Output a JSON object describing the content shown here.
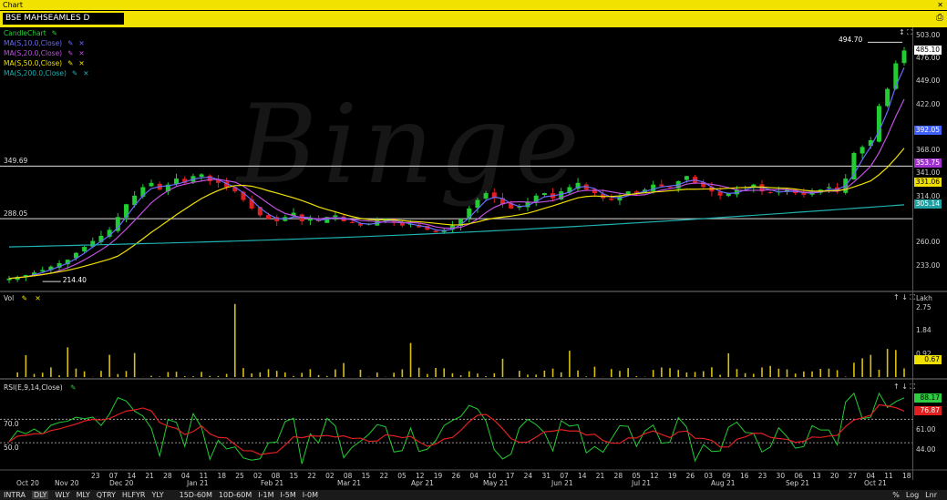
{
  "window": {
    "title": "Chart",
    "close": "✕"
  },
  "symbol": "BSE MAHSEAMLES D",
  "watermark": "Binge",
  "legend_price": [
    {
      "label": "CandleChart",
      "color": "#2ecc40"
    },
    {
      "label": "MA(S,10.0,Close)",
      "color": "#6a6aff"
    },
    {
      "label": "MA(S,20.0,Close)",
      "color": "#c050e0"
    },
    {
      "label": "MA(S,50.0,Close)",
      "color": "#f0e000"
    },
    {
      "label": "MA(S,200.0,Close)",
      "color": "#20b0b0"
    }
  ],
  "legend_vol": "Vol",
  "legend_rsi": "RSI(E,9,14,Close)",
  "price_axis": [
    "503.00",
    "476.00",
    "449.00",
    "422.00",
    "368.00",
    "341.00",
    "314.00",
    "260.00",
    "233.00"
  ],
  "price_tags": [
    {
      "text": "485.10",
      "bg": "#ffffff",
      "fg": "#000"
    },
    {
      "text": "392.05",
      "bg": "#4060ff",
      "fg": "#fff"
    },
    {
      "text": "353.75",
      "bg": "#a030d0",
      "fg": "#fff"
    },
    {
      "text": "331.06",
      "bg": "#f0e000",
      "fg": "#000"
    },
    {
      "text": "305.14",
      "bg": "#20a0a0",
      "fg": "#fff"
    }
  ],
  "price_annotations": {
    "high": "494.70",
    "low": "214.40",
    "line1": "349.69",
    "line2": "288.05"
  },
  "vol_unit": "Lakh",
  "vol_axis": [
    "2.75",
    "1.84",
    "0.92"
  ],
  "vol_tag": "0.67",
  "rsi_axis": [
    "61.00",
    "44.00"
  ],
  "rsi_levels": [
    "70.0",
    "50.0"
  ],
  "rsi_tags": [
    {
      "text": "88.17",
      "bg": "#2ecc40"
    },
    {
      "text": "76.87",
      "bg": "#e02020"
    }
  ],
  "x_days": [
    "23",
    "07",
    "14",
    "21",
    "28",
    "04",
    "11",
    "18",
    "25",
    "02",
    "08",
    "15",
    "22",
    "02",
    "08",
    "15",
    "22",
    "05",
    "12",
    "19",
    "26",
    "04",
    "10",
    "17",
    "24",
    "31",
    "07",
    "14",
    "21",
    "28",
    "05",
    "12",
    "19",
    "26",
    "03",
    "09",
    "16",
    "23",
    "30",
    "06",
    "13",
    "20",
    "27",
    "04",
    "11",
    "18"
  ],
  "x_months": [
    "Oct 20",
    "Nov 20",
    "Dec 20",
    "Jan 21",
    "Feb 21",
    "Mar 21",
    "Apr 21",
    "May 21",
    "Jun 21",
    "Jul 21",
    "Aug 21",
    "Sep 21",
    "Oct 21"
  ],
  "bottom_tabs": [
    "INTRA",
    "DLY",
    "WLY",
    "MLY",
    "QTRY",
    "HLFYR",
    "YLY",
    "15D-60M",
    "10D-60M",
    "I-1M",
    "I-5M",
    "I-0M"
  ],
  "bottom_right": [
    "%",
    "Log",
    "Lnr"
  ],
  "chart_data": {
    "type": "candlestick",
    "title": "BSE MAHSEAMLES D",
    "x_start": "Oct 20",
    "x_end": "Oct 21",
    "ylim": [
      205,
      510
    ],
    "close_approx": [
      218,
      220,
      222,
      225,
      228,
      232,
      236,
      240,
      248,
      255,
      262,
      268,
      275,
      290,
      305,
      315,
      325,
      330,
      322,
      328,
      335,
      330,
      338,
      340,
      332,
      330,
      325,
      320,
      310,
      300,
      292,
      288,
      285,
      290,
      295,
      285,
      288,
      285,
      290,
      292,
      285,
      283,
      280,
      282,
      286,
      288,
      284,
      280,
      282,
      278,
      275,
      272,
      275,
      280,
      288,
      300,
      310,
      318,
      312,
      305,
      300,
      302,
      308,
      315,
      318,
      312,
      320,
      325,
      330,
      322,
      318,
      312,
      310,
      315,
      320,
      318,
      322,
      328,
      326,
      325,
      332,
      338,
      330,
      325,
      320,
      315,
      318,
      322,
      325,
      328,
      320,
      318,
      320,
      322,
      318,
      316,
      320,
      322,
      325,
      320,
      335,
      365,
      372,
      380,
      420,
      440,
      470,
      485
    ],
    "ma_last": {
      "MA10": 392.05,
      "MA20": 353.75,
      "MA50": 331.06,
      "MA200": 305.14
    },
    "last_close": 485.1,
    "high": 494.7,
    "low": 214.4,
    "horizontal_lines": [
      349.69,
      288.05
    ],
    "volume_last": 0.67,
    "rsi_last": [
      88.17,
      76.87
    ]
  }
}
